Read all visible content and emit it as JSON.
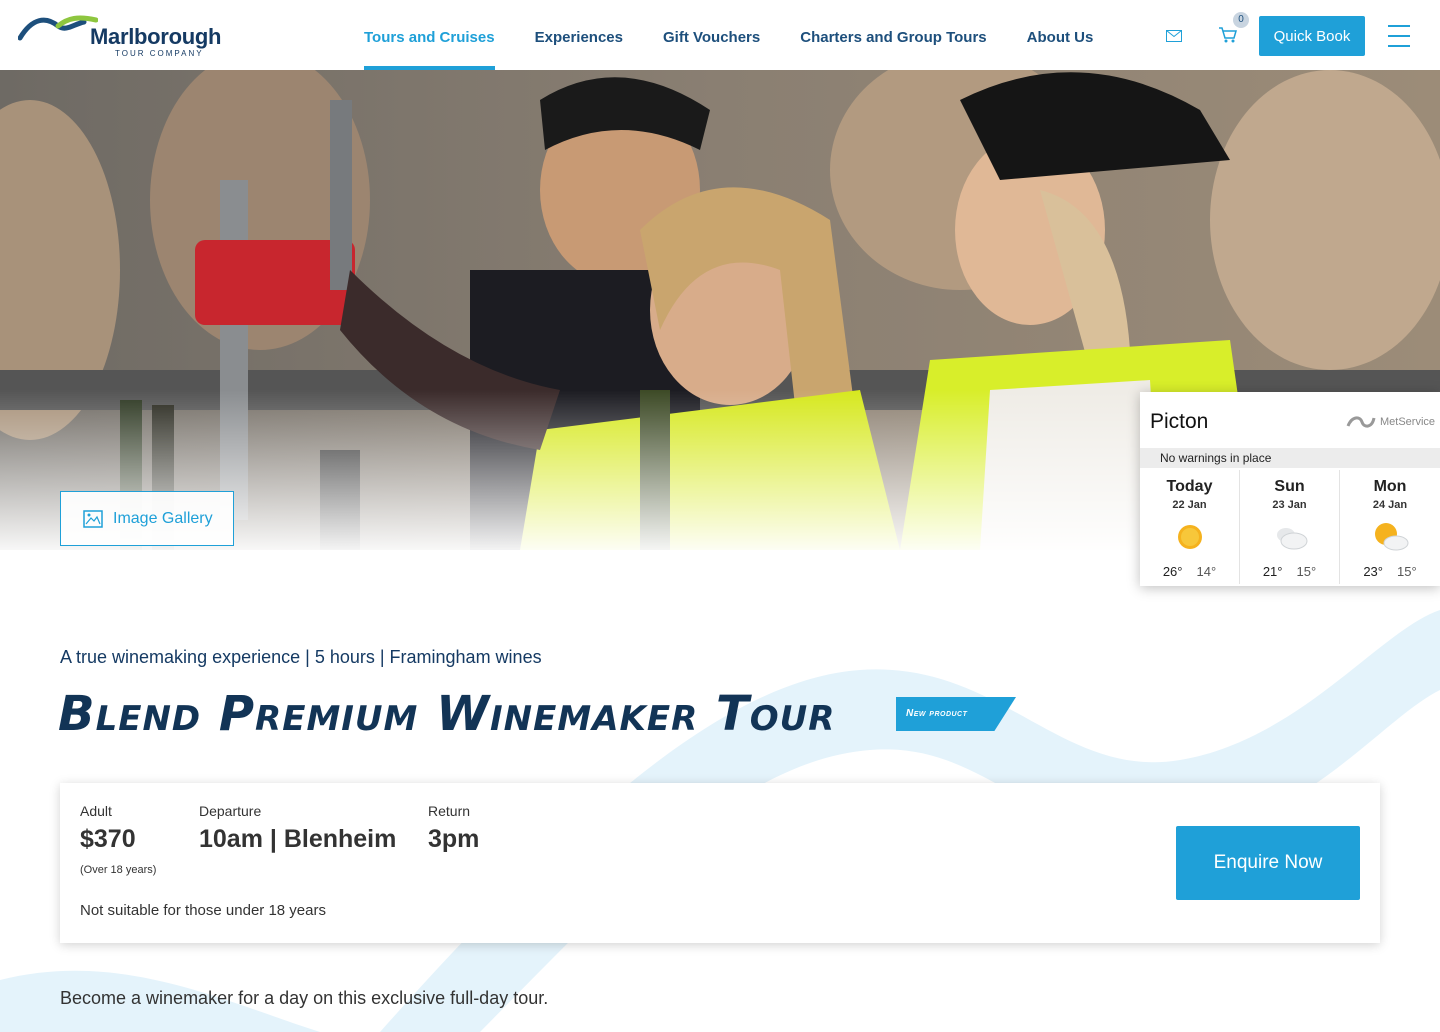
{
  "brand": {
    "name": "Marlborough",
    "sub": "TOUR COMPANY"
  },
  "nav": {
    "items": [
      {
        "label": "Tours and Cruises",
        "active": true
      },
      {
        "label": "Experiences"
      },
      {
        "label": "Gift Vouchers"
      },
      {
        "label": "Charters and Group Tours"
      },
      {
        "label": "About Us"
      }
    ],
    "cart_count": "0",
    "quick_book_label": "Quick Book",
    "icons": [
      "mail-icon",
      "cart-icon",
      "menu-icon"
    ]
  },
  "hero": {
    "gallery_label": "Image Gallery"
  },
  "weather": {
    "city": "Picton",
    "provider": "MetService",
    "warning": "No warnings in place",
    "days": [
      {
        "name": "Today",
        "date": "22 Jan",
        "high": "26°",
        "low": "14°",
        "icon": "sunny-icon"
      },
      {
        "name": "Sun",
        "date": "23 Jan",
        "high": "21°",
        "low": "15°",
        "icon": "cloudy-icon"
      },
      {
        "name": "Mon",
        "date": "24 Jan",
        "high": "23°",
        "low": "15°",
        "icon": "partly-cloudy-icon"
      }
    ]
  },
  "tour": {
    "subtitle": "A true winemaking experience | 5 hours | Framingham wines",
    "title": "Blend Premium Winemaker Tour",
    "badge": "New product",
    "adult_label": "Adult",
    "adult_price": "$370",
    "adult_note": "(Over 18 years)",
    "departure_label": "Departure",
    "departure_value": "10am | Blenheim",
    "return_label": "Return",
    "return_value": "3pm",
    "suitability": "Not suitable for those under 18 years",
    "enquire_label": "Enquire Now",
    "intro": "Become a winemaker for a day on this exclusive full-day tour."
  },
  "colors": {
    "accent": "#1fa0d8",
    "navy": "#153a63"
  }
}
